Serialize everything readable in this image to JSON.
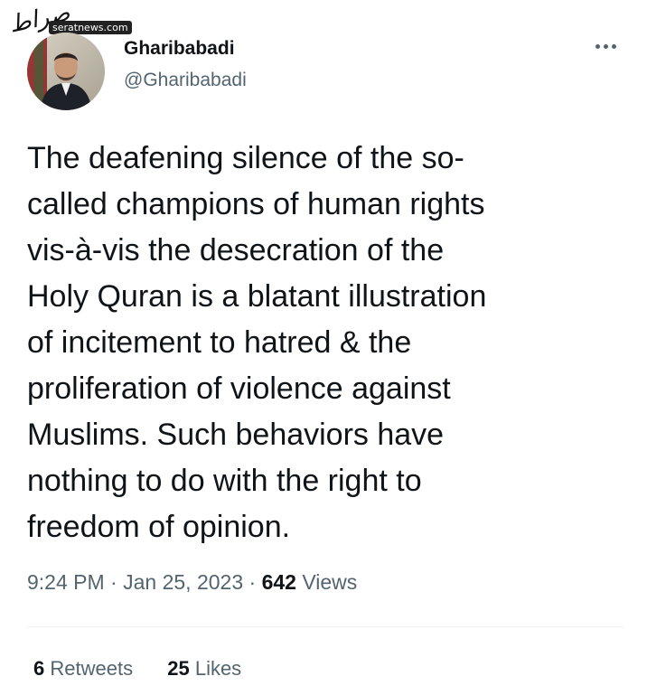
{
  "watermark": {
    "logo": "صراط",
    "url": "seratnews.com"
  },
  "author": {
    "display_name": "Gharibabadi",
    "handle": "@Gharibabadi"
  },
  "more_icon": "more-horizontal-icon",
  "tweet": {
    "text": "The deafening silence of the so-\ncalled champions of human rights\nvis-à-vis the desecration of the\nHoly Quran is a blatant illustration\nof incitement to hatred & the\nproliferation of violence against\nMuslims. Such behaviors have\nnothing to do with the right to\nfreedom of opinion."
  },
  "meta": {
    "time": "9:24 PM",
    "date": "Jan 25, 2023",
    "views_count": "642",
    "views_label": "Views",
    "separator": "·"
  },
  "stats": {
    "retweets_count": "6",
    "retweets_label": "Retweets",
    "likes_count": "25",
    "likes_label": "Likes"
  },
  "colors": {
    "text_primary": "#0f1419",
    "text_secondary": "#536471",
    "divider": "#eff3f4"
  }
}
